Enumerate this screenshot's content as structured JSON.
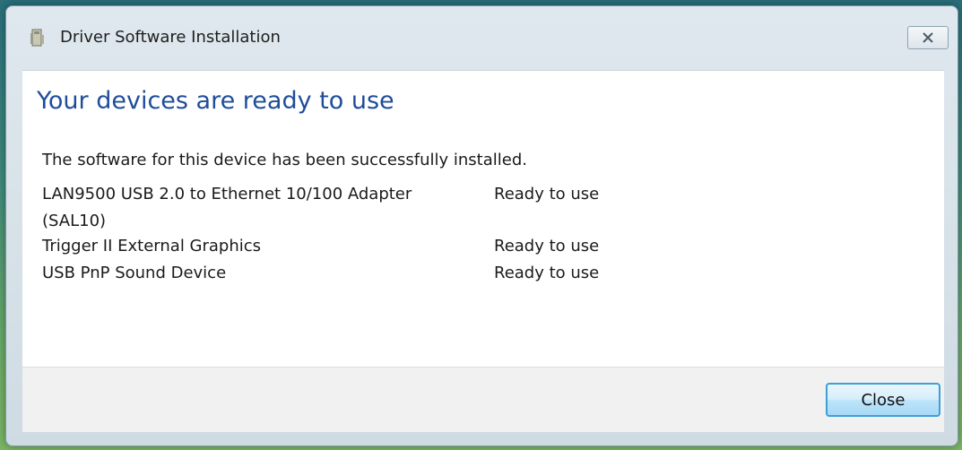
{
  "window": {
    "title": "Driver Software Installation",
    "title_icon": "installer-icon",
    "close_icon": "close-x-icon"
  },
  "content": {
    "heading": "Your devices are ready to use",
    "intro": "The software for this device has been successfully installed.",
    "devices": [
      {
        "name": "LAN9500 USB 2.0 to Ethernet 10/100 Adapter (SAL10)",
        "status": "Ready to use"
      },
      {
        "name": "Trigger II External Graphics",
        "status": "Ready to use"
      },
      {
        "name": "USB PnP Sound Device",
        "status": "Ready to use"
      }
    ]
  },
  "footer": {
    "close_label": "Close"
  },
  "colors": {
    "heading": "#1f4d9a",
    "button_border": "#3c9fd8",
    "desktop": "#3f8a7c"
  }
}
